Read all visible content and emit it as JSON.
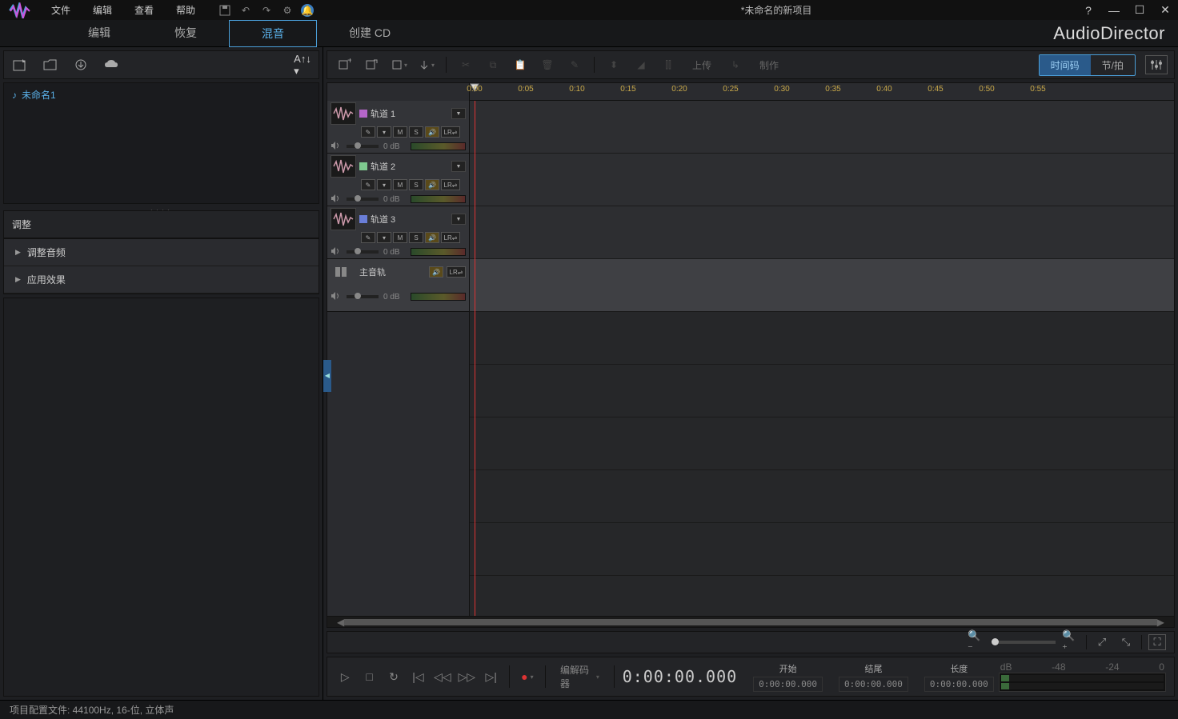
{
  "title": "*未命名的新项目",
  "brand": "AudioDirector",
  "menu": {
    "file": "文件",
    "edit": "编辑",
    "view": "查看",
    "help": "帮助"
  },
  "main_tabs": {
    "edit": "编辑",
    "restore": "恢复",
    "mix": "混音",
    "create_cd": "创建 CD"
  },
  "left": {
    "font_btn": "A↑↓ ▾",
    "file1": "未命名1",
    "adjust_title": "调整",
    "acc_volume": "调整音频",
    "acc_effects": "应用效果"
  },
  "tl_toolbar": {
    "upload": "上传",
    "produce": "制作",
    "timecode": "时间码",
    "beat": "节/拍"
  },
  "ruler_ticks": [
    "0:00",
    "0:05",
    "0:10",
    "0:15",
    "0:20",
    "0:25",
    "0:30",
    "0:35",
    "0:40",
    "0:45",
    "0:50",
    "0:55"
  ],
  "tracks": [
    {
      "name": "轨道 1",
      "color": "#b566c9",
      "db": "0 dB"
    },
    {
      "name": "轨道 2",
      "color": "#7ec98f",
      "db": "0 dB"
    },
    {
      "name": "轨道 3",
      "color": "#6a7ed8",
      "db": "0 dB"
    }
  ],
  "master": {
    "name": "主音轨",
    "db": "0 dB"
  },
  "transport": {
    "codec": "编解码器",
    "timecode": "0:00:00.000",
    "start_lbl": "开始",
    "start_val": "0:00:00.000",
    "end_lbl": "结尾",
    "end_val": "0:00:00.000",
    "len_lbl": "长度",
    "len_val": "0:00:00.000",
    "scale": [
      "dB",
      "-48",
      "-24",
      "0"
    ]
  },
  "status": "项目配置文件: 44100Hz, 16-位, 立体声"
}
